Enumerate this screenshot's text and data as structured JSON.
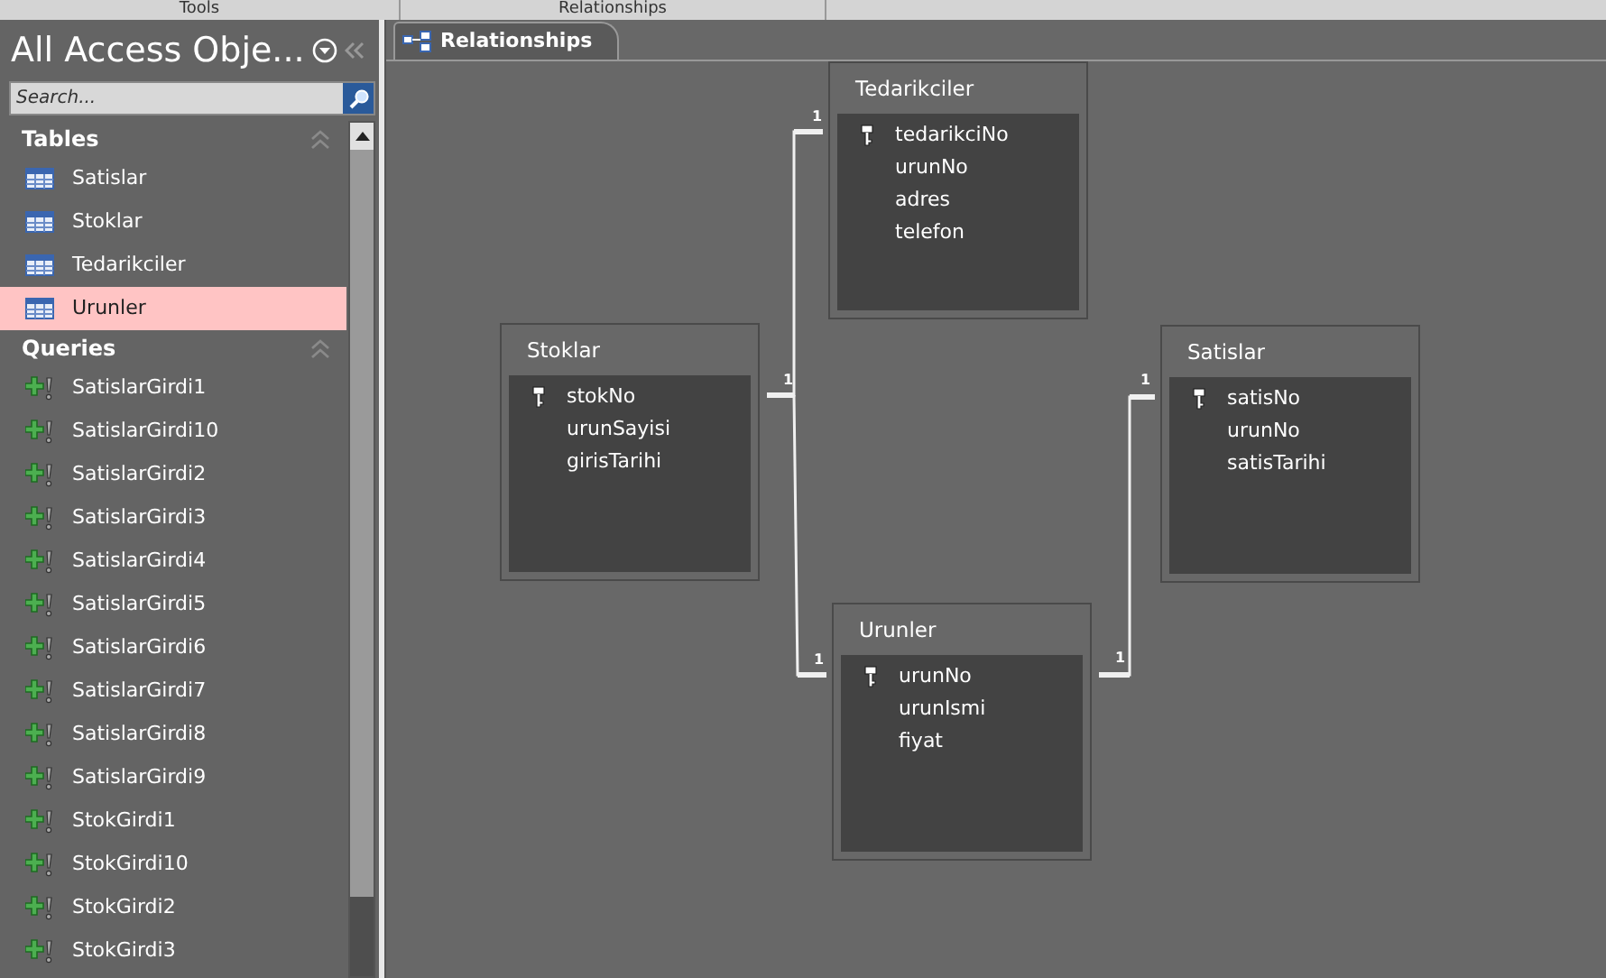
{
  "ribbon_groups": [
    "Tools",
    "Relationships"
  ],
  "navigation_pane": {
    "title": "All Access Obje...",
    "search": {
      "placeholder": "Search..."
    },
    "groups": [
      {
        "label": "Tables",
        "kind": "table",
        "items": [
          {
            "label": "Satislar",
            "selected": false
          },
          {
            "label": "Stoklar",
            "selected": false
          },
          {
            "label": "Tedarikciler",
            "selected": false
          },
          {
            "label": "Urunler",
            "selected": true
          }
        ]
      },
      {
        "label": "Queries",
        "kind": "query",
        "items": [
          {
            "label": "SatislarGirdi1",
            "selected": false
          },
          {
            "label": "SatislarGirdi10",
            "selected": false
          },
          {
            "label": "SatislarGirdi2",
            "selected": false
          },
          {
            "label": "SatislarGirdi3",
            "selected": false
          },
          {
            "label": "SatislarGirdi4",
            "selected": false
          },
          {
            "label": "SatislarGirdi5",
            "selected": false
          },
          {
            "label": "SatislarGirdi6",
            "selected": false
          },
          {
            "label": "SatislarGirdi7",
            "selected": false
          },
          {
            "label": "SatislarGirdi8",
            "selected": false
          },
          {
            "label": "SatislarGirdi9",
            "selected": false
          },
          {
            "label": "StokGirdi1",
            "selected": false
          },
          {
            "label": "StokGirdi10",
            "selected": false
          },
          {
            "label": "StokGirdi2",
            "selected": false
          },
          {
            "label": "StokGirdi3",
            "selected": false
          }
        ]
      }
    ]
  },
  "document_tabs": [
    {
      "label": "Relationships",
      "selected": true
    }
  ],
  "tables": [
    {
      "name": "Tedarikciler",
      "fields": [
        {
          "name": "tedarikciNo",
          "primary_key": true
        },
        {
          "name": "urunNo",
          "primary_key": false
        },
        {
          "name": "adres",
          "primary_key": false
        },
        {
          "name": "telefon",
          "primary_key": false
        }
      ]
    },
    {
      "name": "Stoklar",
      "fields": [
        {
          "name": "stokNo",
          "primary_key": true
        },
        {
          "name": "urunSayisi",
          "primary_key": false
        },
        {
          "name": "girisTarihi",
          "primary_key": false
        }
      ]
    },
    {
      "name": "Satislar",
      "fields": [
        {
          "name": "satisNo",
          "primary_key": true
        },
        {
          "name": "urunNo",
          "primary_key": false
        },
        {
          "name": "satisTarihi",
          "primary_key": false
        }
      ]
    },
    {
      "name": "Urunler",
      "fields": [
        {
          "name": "urunNo",
          "primary_key": true
        },
        {
          "name": "urunIsmi",
          "primary_key": false
        },
        {
          "name": "fiyat",
          "primary_key": false
        }
      ]
    }
  ],
  "relationships": [
    {
      "labels": [
        "1",
        "1"
      ]
    },
    {
      "labels": [
        "1"
      ]
    },
    {
      "labels": [
        "1",
        "1"
      ]
    }
  ]
}
